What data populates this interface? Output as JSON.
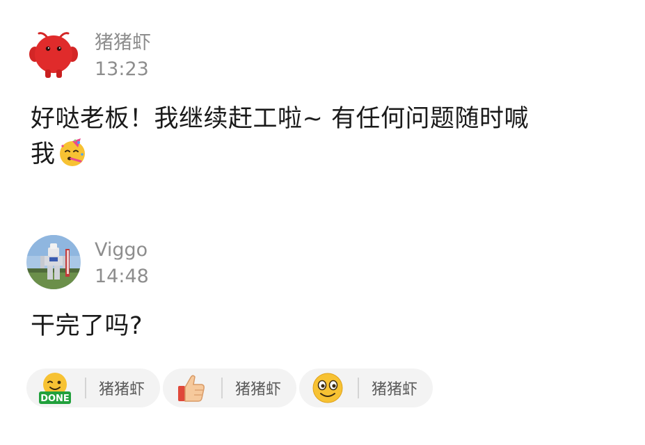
{
  "messages": [
    {
      "sender": "猪猪虾",
      "time": "13:23",
      "text_line1": "好哒老板！我继续赶工啦~ 有任何问题随时喊",
      "text_line2": "我",
      "avatar_icon": "red-shrimp-mascot-avatar",
      "inline_emoji": "party-face-emoji"
    },
    {
      "sender": "Viggo",
      "time": "14:48",
      "text": "干完了吗?",
      "avatar_icon": "gundam-statue-photo-avatar"
    }
  ],
  "reactions": [
    {
      "icon": "done-emoji",
      "badge_text": "DONE",
      "user": "猪猪虾"
    },
    {
      "icon": "thumbs-up-emoji",
      "user": "猪猪虾"
    },
    {
      "icon": "smiley-emoji",
      "user": "猪猪虾"
    }
  ],
  "colors": {
    "background": "#ffffff",
    "secondary_text": "#8d8d8d",
    "chip_background": "#f3f3f3",
    "mascot_red": "#e02b2b"
  }
}
